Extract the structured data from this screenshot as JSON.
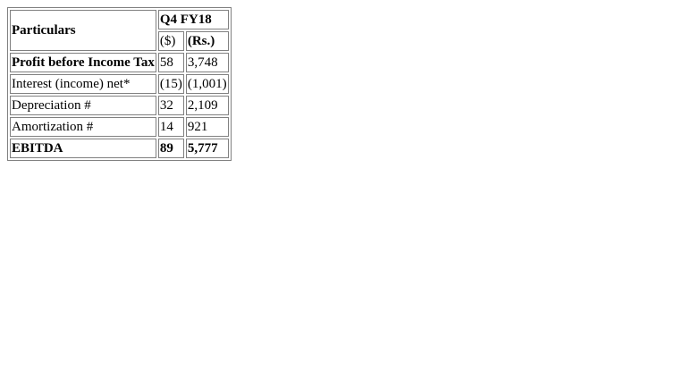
{
  "table": {
    "header": {
      "particulars": "Particulars",
      "period": "Q4 FY18",
      "col_usd": "($)",
      "col_inr": "(Rs.)"
    },
    "rows": [
      {
        "label": "Profit before Income Tax",
        "usd": "58",
        "inr": "3,748",
        "bold": true
      },
      {
        "label": "Interest (income) net*",
        "usd": "(15)",
        "inr": "(1,001)",
        "bold": false
      },
      {
        "label": "Depreciation #",
        "usd": "32",
        "inr": "2,109",
        "bold": false
      },
      {
        "label": "Amortization #",
        "usd": "14",
        "inr": "921",
        "bold": false
      },
      {
        "label": "EBITDA",
        "usd": "89",
        "inr": "5,777",
        "bold": true
      }
    ]
  }
}
